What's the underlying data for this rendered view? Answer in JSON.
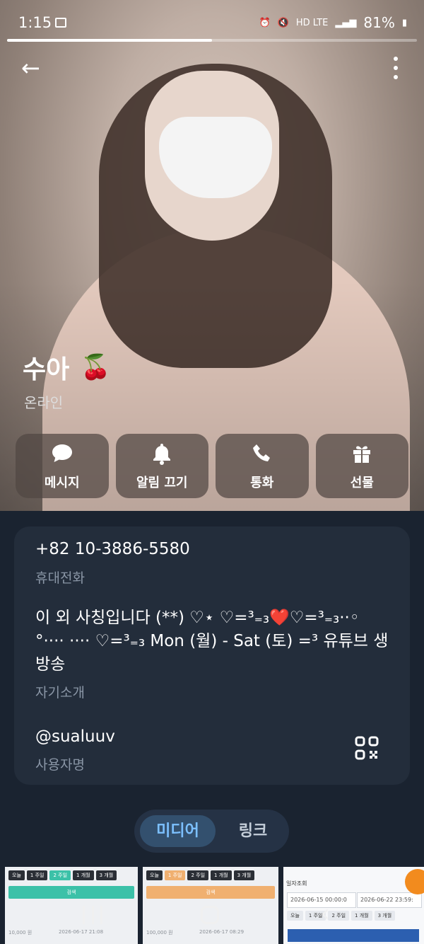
{
  "status_bar": {
    "time": "1:15",
    "network": "HD LTE",
    "battery": "81%"
  },
  "story_progress": 0.5,
  "profile": {
    "name": "수아",
    "name_emoji": "🍒",
    "status": "온라인"
  },
  "actions": [
    {
      "label": "메시지",
      "icon": "chat-bubble-icon"
    },
    {
      "label": "알림 끄기",
      "icon": "bell-icon"
    },
    {
      "label": "통화",
      "icon": "phone-icon"
    },
    {
      "label": "선물",
      "icon": "gift-icon"
    }
  ],
  "info": {
    "phone": "+82 10-3886-5580",
    "phone_label": "휴대전화",
    "bio": "이 외 사칭입니다 (**) ♡⋆ ♡=³₌₃❤️♡=³₌₃··◦ °···· ···· ♡=³₌₃ Mon (월) - Sat (토) =³ 유튜브 생방송",
    "bio_label": "자기소개",
    "username": "@sualuuv",
    "username_label": "사용자명"
  },
  "tabs": [
    {
      "label": "미디어",
      "active": true
    },
    {
      "label": "링크",
      "active": false
    }
  ],
  "thumbnails": {
    "t1": {
      "chips": [
        "오늘",
        "1 주일",
        "2 주일",
        "1 개월",
        "3 개월"
      ],
      "active": "2 주일",
      "search": "검색",
      "row1": "10,000 원",
      "row2": "2026-06-17 21:08"
    },
    "t2": {
      "chips": [
        "오늘",
        "1 주일",
        "2 주일",
        "1 개월",
        "3 개월"
      ],
      "active": "1 주일",
      "search": "검색",
      "row1": "100,000 원",
      "row2": "2026-06-17 08:29"
    },
    "t3": {
      "title": "일자조회",
      "date_from": "2026-06-15 00:00:0",
      "date_to": "2026-06-22 23:59:",
      "chips": [
        "오늘",
        "1 주일",
        "2 주일",
        "1 개월",
        "3 개월"
      ]
    }
  },
  "colors": {
    "background": "#1a2330",
    "card": "#232d3b",
    "accent": "#7cc0ff",
    "thumb_green": "#3cc1a8",
    "thumb_orange": "#f0b070"
  }
}
